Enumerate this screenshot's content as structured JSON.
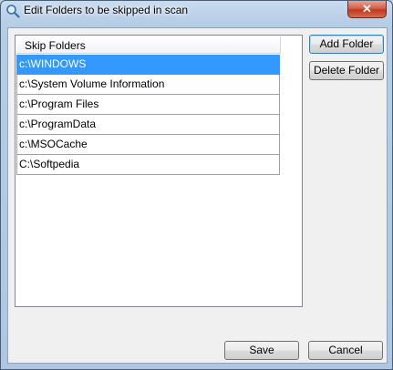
{
  "window": {
    "title": "Edit Folders to be skipped in scan",
    "close_glyph": "✕",
    "icon": "search-icon"
  },
  "list": {
    "header": "Skip Folders",
    "selected_index": 0,
    "rows": [
      "c:\\WINDOWS",
      "c:\\System Volume Information",
      "c:\\Program Files",
      "c:\\ProgramData",
      "c:\\MSOCache",
      "C:\\Softpedia"
    ]
  },
  "buttons": {
    "add_folder": "Add Folder",
    "delete_folder": "Delete Folder",
    "save": "Save",
    "cancel": "Cancel"
  },
  "colors": {
    "selection": "#3399ff",
    "close_button": "#c0391f"
  }
}
